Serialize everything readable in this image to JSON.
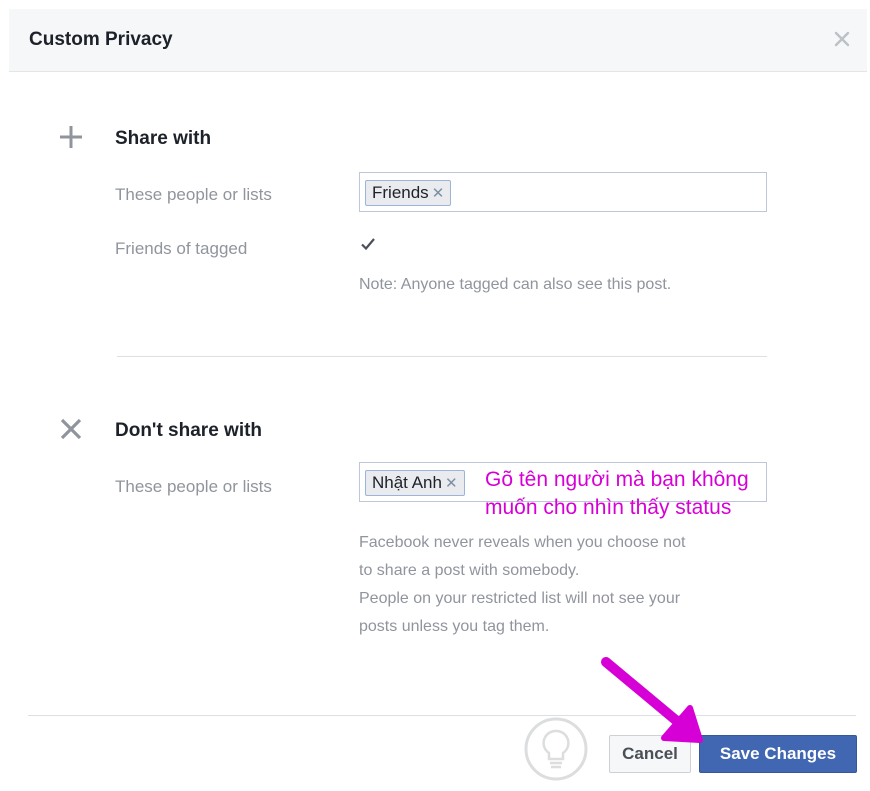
{
  "dialog": {
    "title": "Custom Privacy",
    "close_icon": "close-icon"
  },
  "share_with": {
    "icon": "plus-icon",
    "title": "Share with",
    "people_label": "These people or lists",
    "token": "Friends",
    "friends_of_tagged_label": "Friends of tagged",
    "friends_of_tagged_checked": true,
    "note": "Note: Anyone tagged can also see this post."
  },
  "dont_share_with": {
    "icon": "close-x-icon",
    "title": "Don't share with",
    "people_label": "These people or lists",
    "token": "Nhật Anh",
    "note_line1": "Facebook never reveals when you choose not",
    "note_line2": "to share a post with somebody.",
    "note_line3": "People on your restricted list will not see your",
    "note_line4": "posts unless you tag them."
  },
  "annotation": {
    "line1": "Gõ tên người mà bạn không",
    "line2": "muốn cho nhìn thấy status",
    "color": "#d600d6"
  },
  "footer": {
    "cancel_label": "Cancel",
    "save_label": "Save Changes"
  },
  "colors": {
    "primary_button": "#4267b2",
    "header_bg": "#f6f7f9",
    "arrow": "#d600d6"
  }
}
